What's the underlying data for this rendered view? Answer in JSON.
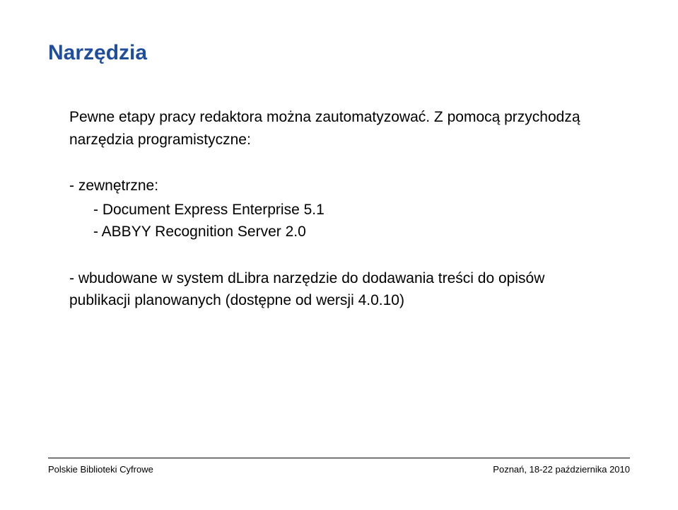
{
  "title": "Narzędzia",
  "intro": "Pewne etapy pracy redaktora można zautomatyzować. Z pomocą przychodzą narzędzia programistyczne:",
  "external_label": "- zewnętrzne:",
  "external_items": [
    "- Document Express Enterprise 5.1",
    "- ABBYY Recognition Server 2.0"
  ],
  "builtin": "- wbudowane w system dLibra narzędzie do dodawania treści do opisów publikacji planowanych (dostępne od wersji 4.0.10)",
  "footer_left": "Polskie Biblioteki Cyfrowe",
  "footer_right": "Poznań, 18-22 października 2010"
}
